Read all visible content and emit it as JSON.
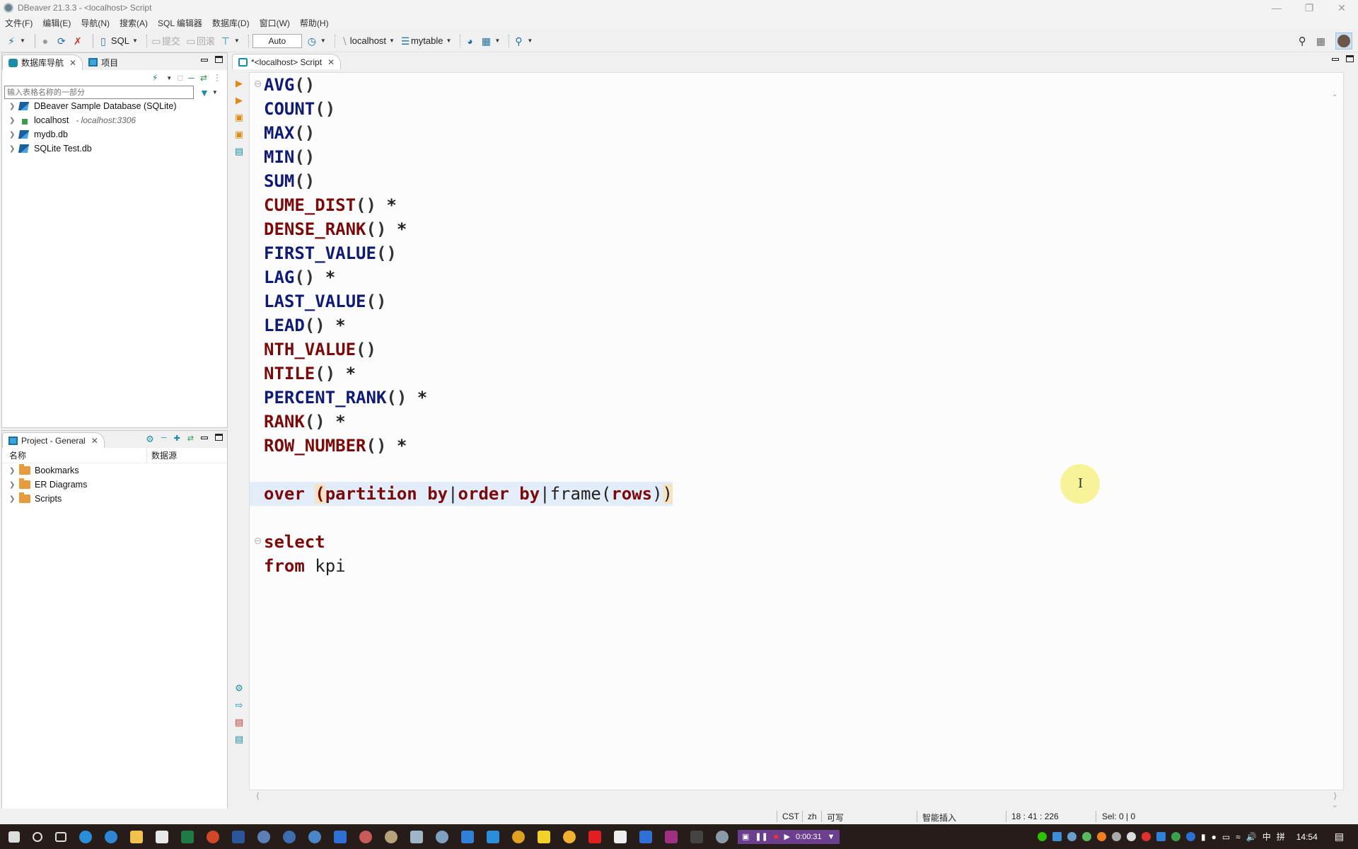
{
  "window": {
    "title": "DBeaver 21.3.3 - <localhost> Script",
    "controls": [
      "minimize",
      "restore",
      "close"
    ]
  },
  "menu": [
    "文件(F)",
    "编辑(E)",
    "导航(N)",
    "搜索(A)",
    "SQL 编辑器",
    "数据库(D)",
    "窗口(W)",
    "帮助(H)"
  ],
  "toolbar": {
    "sql_label": "SQL",
    "commit_label": "提交",
    "rollback_label": "回滚",
    "transaction_mode": "Auto",
    "datasource": "localhost",
    "schema": "mytable"
  },
  "db_navigator": {
    "tab_label": "数据库导航",
    "project_tab_label": "项目",
    "filter_placeholder": "输入表格名称的一部分",
    "items": [
      {
        "label": "DBeaver Sample Database (SQLite)",
        "sub": ""
      },
      {
        "label": "localhost",
        "sub": "- localhost:3306"
      },
      {
        "label": "mydb.db",
        "sub": ""
      },
      {
        "label": "SQLite Test.db",
        "sub": ""
      }
    ]
  },
  "project_panel": {
    "tab_label": "Project - General",
    "col_name": "名称",
    "col_datasource": "数据源",
    "items": [
      {
        "label": "Bookmarks"
      },
      {
        "label": "ER Diagrams"
      },
      {
        "label": "Scripts"
      }
    ]
  },
  "editor": {
    "tab_label": "*<localhost> Script",
    "lines": [
      {
        "fn": "AVG",
        "args": "()",
        "mark": "",
        "color": "blue"
      },
      {
        "fn": "COUNT",
        "args": "()",
        "mark": "",
        "color": "blue"
      },
      {
        "fn": "MAX",
        "args": "()",
        "mark": "",
        "color": "blue"
      },
      {
        "fn": "MIN",
        "args": "()",
        "mark": "",
        "color": "blue"
      },
      {
        "fn": "SUM",
        "args": "()",
        "mark": "",
        "color": "blue"
      },
      {
        "fn": "CUME_DIST",
        "args": "()",
        "mark": " *",
        "color": "red"
      },
      {
        "fn": "DENSE_RANK",
        "args": "()",
        "mark": " *",
        "color": "red"
      },
      {
        "fn": "FIRST_VALUE",
        "args": "()",
        "mark": "",
        "color": "blue"
      },
      {
        "fn": "LAG",
        "args": "()",
        "mark": " *",
        "color": "blue"
      },
      {
        "fn": "LAST_VALUE",
        "args": "()",
        "mark": "",
        "color": "blue"
      },
      {
        "fn": "LEAD",
        "args": "()",
        "mark": " *",
        "color": "blue"
      },
      {
        "fn": "NTH_VALUE",
        "args": "()",
        "mark": "",
        "color": "red"
      },
      {
        "fn": "NTILE",
        "args": "()",
        "mark": " *",
        "color": "red"
      },
      {
        "fn": "PERCENT_RANK",
        "args": "()",
        "mark": " *",
        "color": "blue"
      },
      {
        "fn": "RANK",
        "args": "()",
        "mark": " *",
        "color": "red"
      },
      {
        "fn": "ROW_NUMBER",
        "args": "()",
        "mark": " *",
        "color": "red"
      }
    ],
    "over_line": {
      "kw_over": "over",
      "open": "(",
      "partition": "partition by",
      "pipe1": "|",
      "order": "order by",
      "pipe2": "|",
      "frame": "frame(",
      "rows": "rows",
      "close_inner": ")",
      "close": ")"
    },
    "select_kw": "select",
    "from_kw": "from",
    "table": "kpi"
  },
  "statusbar": {
    "timezone": "CST",
    "locale": "zh",
    "mode": "可写",
    "insert_mode": "智能插入",
    "position": "18 : 41 : 226",
    "selection": "Sel: 0 | 0"
  },
  "taskbar": {
    "recording_time": "0:00:31",
    "clock": "14:54",
    "ime": "中",
    "ime2": "拼"
  }
}
